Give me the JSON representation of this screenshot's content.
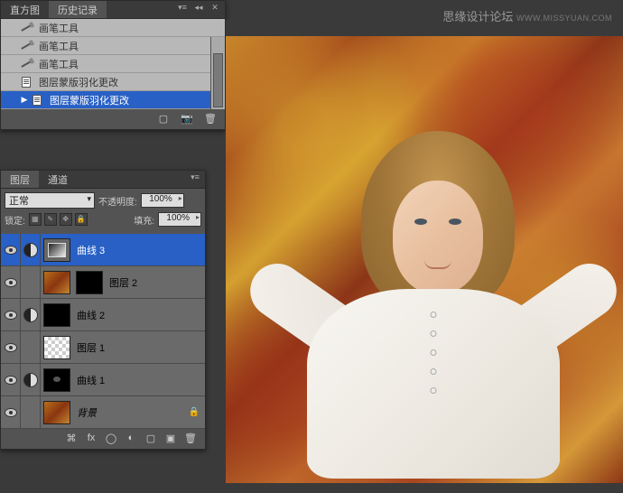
{
  "watermark": {
    "text": "思缘设计论坛",
    "sub": "WWW.MISSYUAN.COM"
  },
  "history": {
    "tabs": [
      "直方图",
      "历史记录"
    ],
    "active_tab": 1,
    "items": [
      {
        "icon": "brush",
        "label": "画笔工具"
      },
      {
        "icon": "brush",
        "label": "画笔工具"
      },
      {
        "icon": "brush",
        "label": "画笔工具"
      },
      {
        "icon": "doc",
        "label": "图层蒙版羽化更改"
      },
      {
        "icon": "doc",
        "label": "图层蒙版羽化更改",
        "selected": true
      }
    ]
  },
  "layers": {
    "tabs": [
      "图层",
      "通道"
    ],
    "active_tab": 0,
    "blend_mode": "正常",
    "opacity_label": "不透明度:",
    "opacity": "100%",
    "lock_label": "锁定:",
    "fill_label": "填充:",
    "fill": "100%",
    "items": [
      {
        "type": "adj",
        "mask": "curves",
        "name": "曲线 3",
        "selected": true
      },
      {
        "type": "img",
        "mask": "black",
        "name": "图层 2"
      },
      {
        "type": "adj",
        "mask": "black",
        "name": "曲线 2"
      },
      {
        "type": "checker",
        "name": "图层 1"
      },
      {
        "type": "adj",
        "mask": "spot",
        "name": "曲线 1"
      },
      {
        "type": "img",
        "name": "背景",
        "italic": true,
        "locked": true
      }
    ]
  }
}
